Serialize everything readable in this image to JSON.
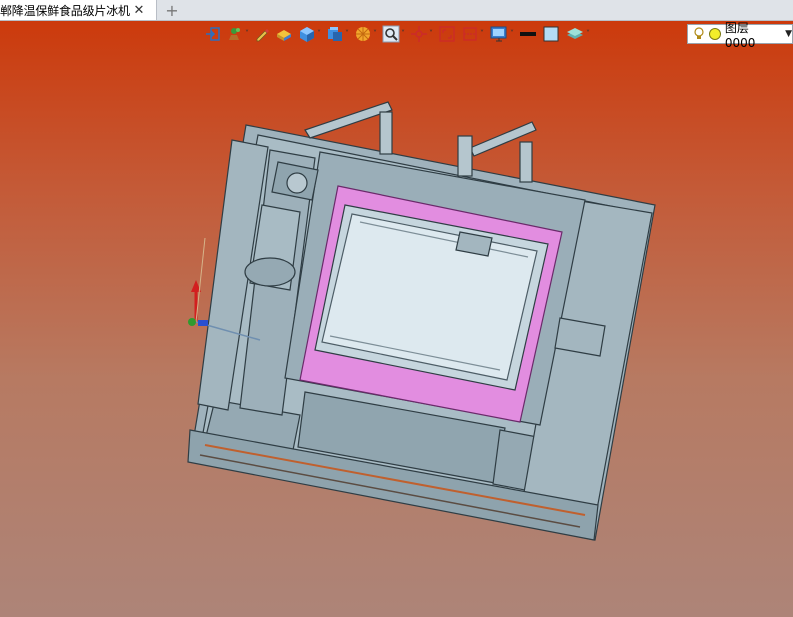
{
  "tab": {
    "title": "郸降温保鲜食品级片冰机]",
    "close_glyph": "✕",
    "new_glyph": "+"
  },
  "toolbar": {
    "icons": [
      "exit-sketch-icon",
      "plant-icon",
      "pen-icon",
      "block-icon",
      "cube-icon",
      "cube-stack-icon",
      "wheel-icon",
      "zoom-icon",
      "crosshair-icon",
      "fit-icon",
      "section-icon",
      "monitor-icon",
      "line-style-icon",
      "color-swatch-icon",
      "layer-stack-icon"
    ],
    "layer_label": "图层0000"
  },
  "colors": {
    "bg_top": "#cc3a0c",
    "bg_bottom": "#ad8478",
    "model": "#9fb2bc",
    "model_dark": "#2f3d44",
    "magenta": "#e28de0"
  }
}
